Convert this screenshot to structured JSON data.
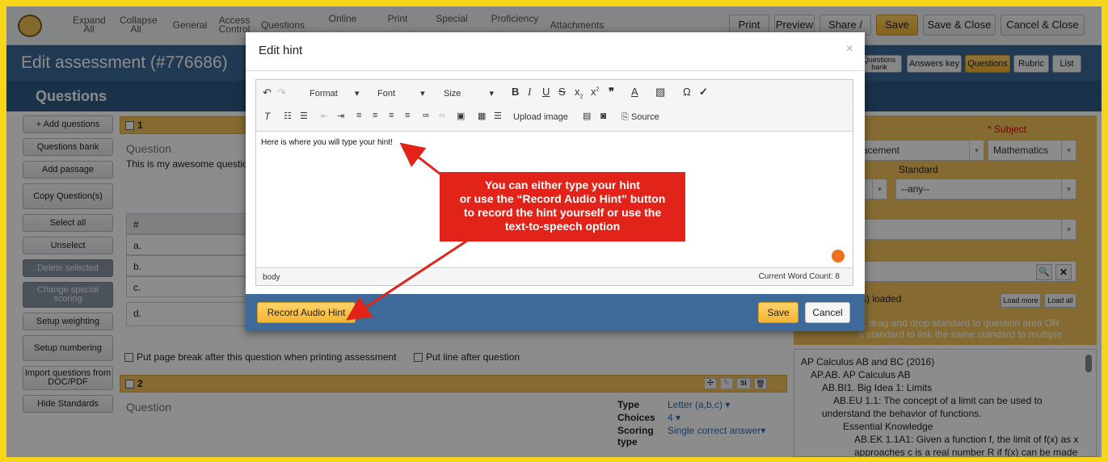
{
  "nav": {
    "items": [
      "Expand All",
      "Collapse All",
      "General",
      "Access Control",
      "Questions",
      "Online",
      "Print",
      "Special",
      "Proficiency",
      "Attachments"
    ],
    "print_label": "Print",
    "preview_label": "Preview",
    "share_label": "Share /",
    "save_label": "Save",
    "save_close_label": "Save & Close",
    "cancel_close_label": "Cancel & Close"
  },
  "title": {
    "text": "Edit assessment (#776686)",
    "tabs": [
      "Questions bank",
      "Answers key",
      "Questions",
      "Rubric",
      "List"
    ]
  },
  "section_title": "Questions",
  "sidebar": {
    "buttons": [
      "+ Add questions",
      "Questions bank",
      "Add passage",
      "Copy Question(s)",
      "Select all",
      "Unselect",
      "Delete selected",
      "Change special scoring",
      "Setup weighting",
      "Setup numbering",
      "Import questions from DOC/PDF",
      "Hide Standards"
    ]
  },
  "question1": {
    "number": "1",
    "label": "Question",
    "text": "This is my awesome questio",
    "table_header": "#",
    "options": [
      "a.",
      "b.",
      "c.",
      "d."
    ],
    "page_break_label": "Put page break after this question when printing assessment",
    "line_after_label": "Put line after question"
  },
  "question2": {
    "number": "2",
    "label": "Question",
    "type_label": "Type",
    "type_value": "Letter (a,b,c)",
    "choices_label": "Choices",
    "choices_value": "4",
    "scoring_label": "Scoring type",
    "scoring_value": "Single correct answer",
    "tool_si": "SI"
  },
  "right_panel": {
    "subject_label": "* Subject",
    "placement_value": "acement",
    "subject_value": "Mathematics",
    "standard_label": "Standard",
    "standard_value": "--any--",
    "fragment_e": "e",
    "loaded_text": "(s) loaded",
    "load_more": "Load more",
    "load_all": "Load all",
    "hint_line1": "d, drag and drop standard to question area OR",
    "hint_line2": "a standard to link the same standard to multiple"
  },
  "standards": [
    "AP Calculus AB and BC (2016)",
    "AP.AB. AP Calculus AB",
    "AB.BI1. Big Idea 1: Limits",
    "AB.EU 1.1: The concept of a limit can be used to",
    "understand the behavior of functions.",
    "Essential Knowledge",
    "AB.EK 1.1A1: Given a function f, the limit of f(x) as x",
    "approaches c is a real number R if f(x) can be made"
  ],
  "modal": {
    "title": "Edit hint",
    "close": "×",
    "toolbar": {
      "format": "Format",
      "font": "Font",
      "size": "Size",
      "upload_image": "Upload image",
      "source": "Source"
    },
    "content": "Here is where you will type your hint!",
    "status_left": "body",
    "status_right": "Current Word Count: 8",
    "record_label": "Record Audio Hint",
    "save_label": "Save",
    "cancel_label": "Cancel"
  },
  "callout": {
    "line1": "You can either type your hint",
    "line2": "or use the “Record Audio Hint” button",
    "line3": "to record the hint yourself or use the",
    "line4": "text-to-speech option"
  },
  "colors": {
    "accent": "#f4b430",
    "header_blue": "#3d6a99",
    "callout_red": "#e2231a",
    "frame_yellow": "#f6d51a"
  }
}
